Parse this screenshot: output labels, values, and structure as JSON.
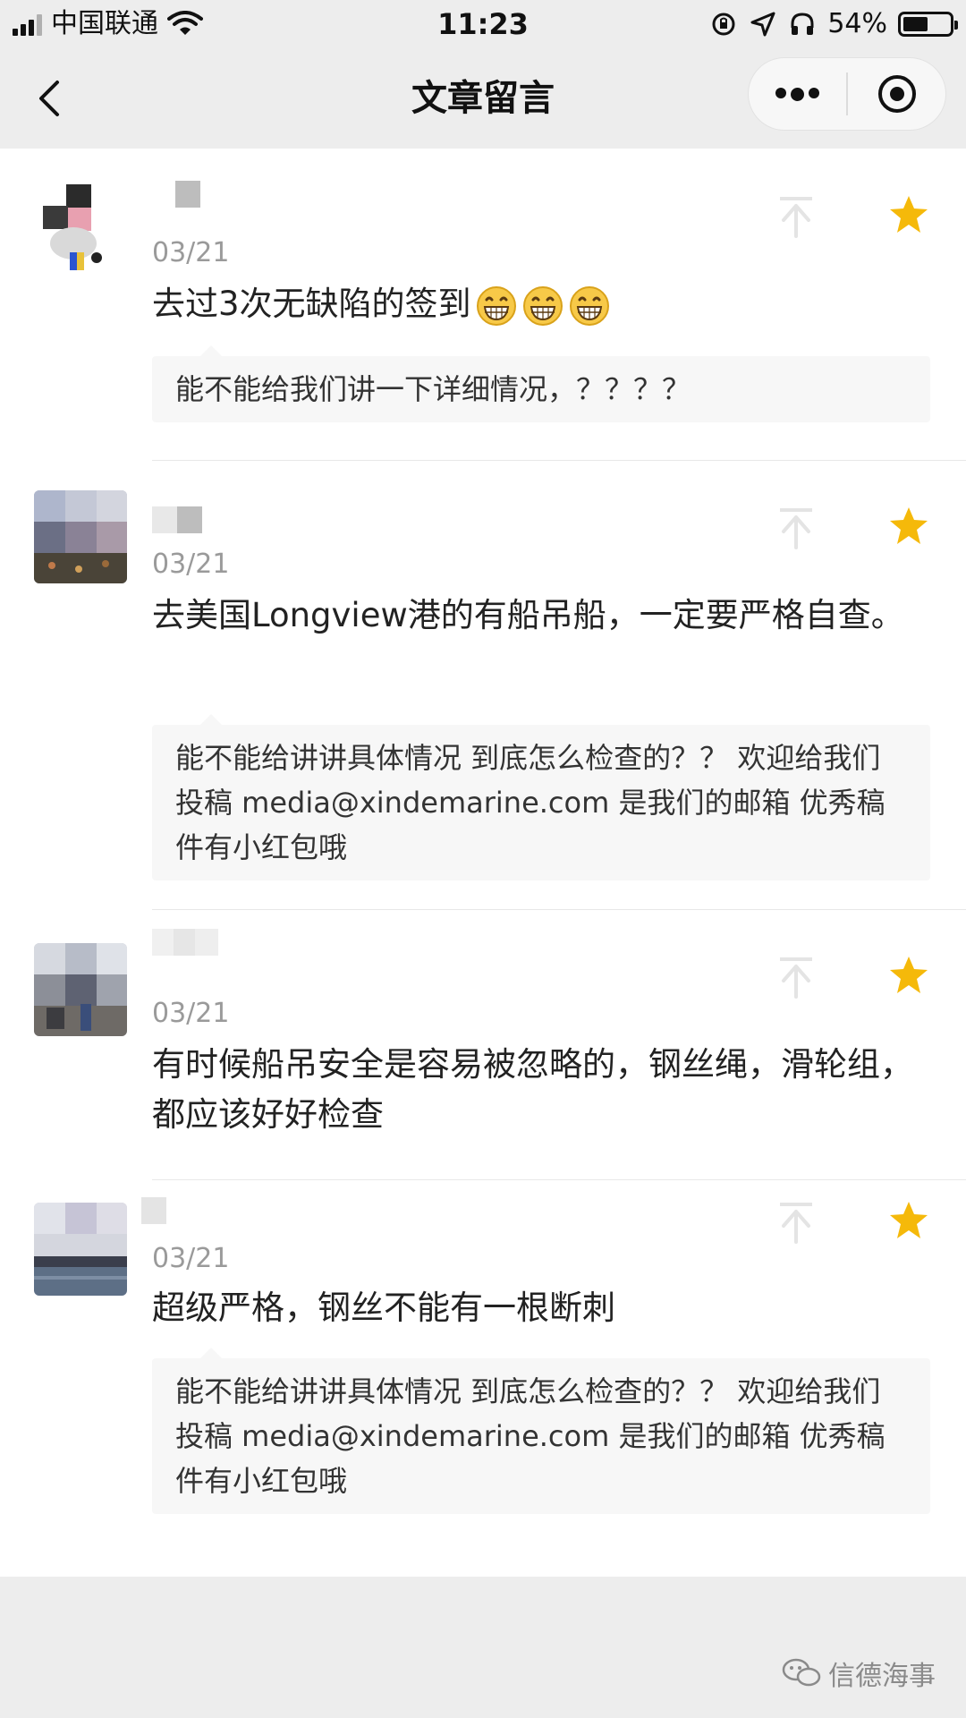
{
  "status_bar": {
    "carrier": "中国联通",
    "time": "11:23",
    "battery_percent": "54%",
    "battery_level": 0.54
  },
  "nav": {
    "title": "文章留言",
    "more_icon": "more-dots-icon",
    "close_icon": "target-circle-icon"
  },
  "comments": [
    {
      "date": "03/21",
      "text": "去过3次无缺陷的签到",
      "emoji_count": 3,
      "reply": "能不能给我们讲一下详细情况，？？？？"
    },
    {
      "date": "03/21",
      "text": "去美国Longview港的有船吊船，一定要严格自查。",
      "reply": "能不能给讲讲具体情况 到底怎么检查的？？ 欢迎给我们投稿 media@xindemarine.com 是我们的邮箱 优秀稿件有小红包哦"
    },
    {
      "date": "03/21",
      "text": "有时候船吊安全是容易被忽略的，钢丝绳，滑轮组，都应该好好检查",
      "reply": ""
    },
    {
      "date": "03/21",
      "text": "超级严格，钢丝不能有一根断刺",
      "reply": "能不能给讲讲具体情况 到底怎么检查的？？ 欢迎给我们投稿 media@xindemarine.com 是我们的邮箱 优秀稿件有小红包哦"
    }
  ],
  "footer": {
    "watermark": "信德海事"
  },
  "colors": {
    "star": "#f5b90a",
    "page_bg": "#ededed",
    "reply_bg": "#f7f7f7"
  }
}
